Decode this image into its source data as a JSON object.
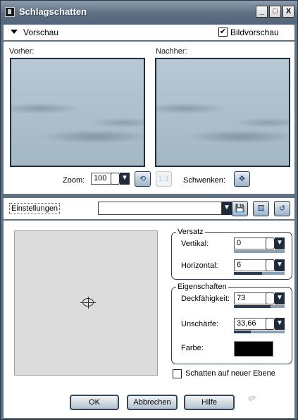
{
  "window": {
    "title": "Schlagschatten",
    "controls": [
      "_",
      "□",
      "X"
    ]
  },
  "preview_section": {
    "label": "Vorschau",
    "bildvorschau_label": "Bildvorschau",
    "bildvorschau_checked": true,
    "before_label": "Vorher:",
    "after_label": "Nachher:",
    "zoom_label": "Zoom:",
    "zoom_value": "100",
    "schwenken_label": "Schwenken:"
  },
  "settings": {
    "label": "Einstellungen",
    "preset_value": ""
  },
  "versatz": {
    "legend": "Versatz",
    "vertikal_label": "Vertikal:",
    "vertikal_value": "0",
    "horizontal_label": "Horizontal:",
    "horizontal_value": "6"
  },
  "eigenschaften": {
    "legend": "Eigenschaften",
    "deckfaehigkeit_label": "Deckfähigkeit:",
    "deckfaehigkeit_value": "73",
    "unschaerfe_label": "Unschärfe:",
    "unschaerfe_value": "33,66",
    "farbe_label": "Farbe:",
    "farbe_color": "#000000"
  },
  "options": {
    "neue_ebene_label": "Schatten auf neuer Ebene",
    "neue_ebene_checked": false
  },
  "buttons": {
    "ok": "OK",
    "cancel": "Abbrechen",
    "help": "Hilfe"
  }
}
